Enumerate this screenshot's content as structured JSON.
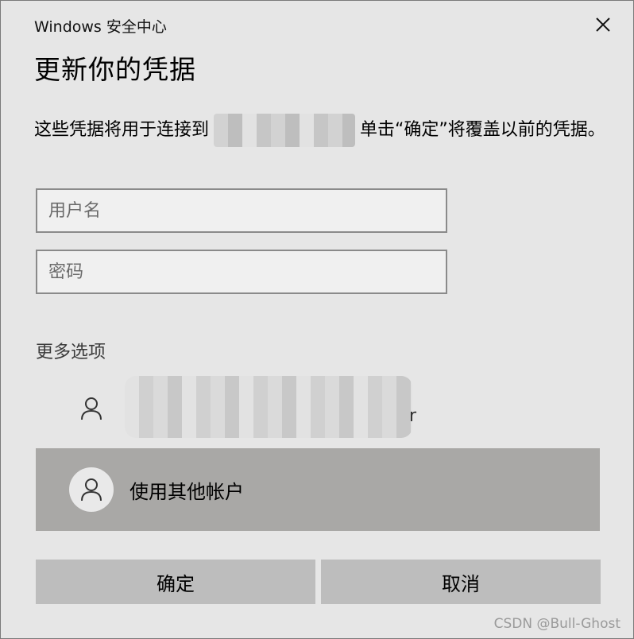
{
  "window": {
    "title": "Windows 安全中心"
  },
  "heading": "更新你的凭据",
  "description": {
    "before": "这些凭据将用于连接到",
    "after": "单击“确定”将覆盖以前的凭据。"
  },
  "fields": {
    "username_placeholder": "用户名",
    "password_placeholder": "密码"
  },
  "more_options": "更多选项",
  "accounts": {
    "saved_account_suffix": "r",
    "other_account_label": "使用其他帐户"
  },
  "buttons": {
    "ok": "确定",
    "cancel": "取消"
  },
  "icons": {
    "close": "close-icon",
    "person": "person-icon"
  },
  "watermark": "CSDN @Bull-Ghost"
}
